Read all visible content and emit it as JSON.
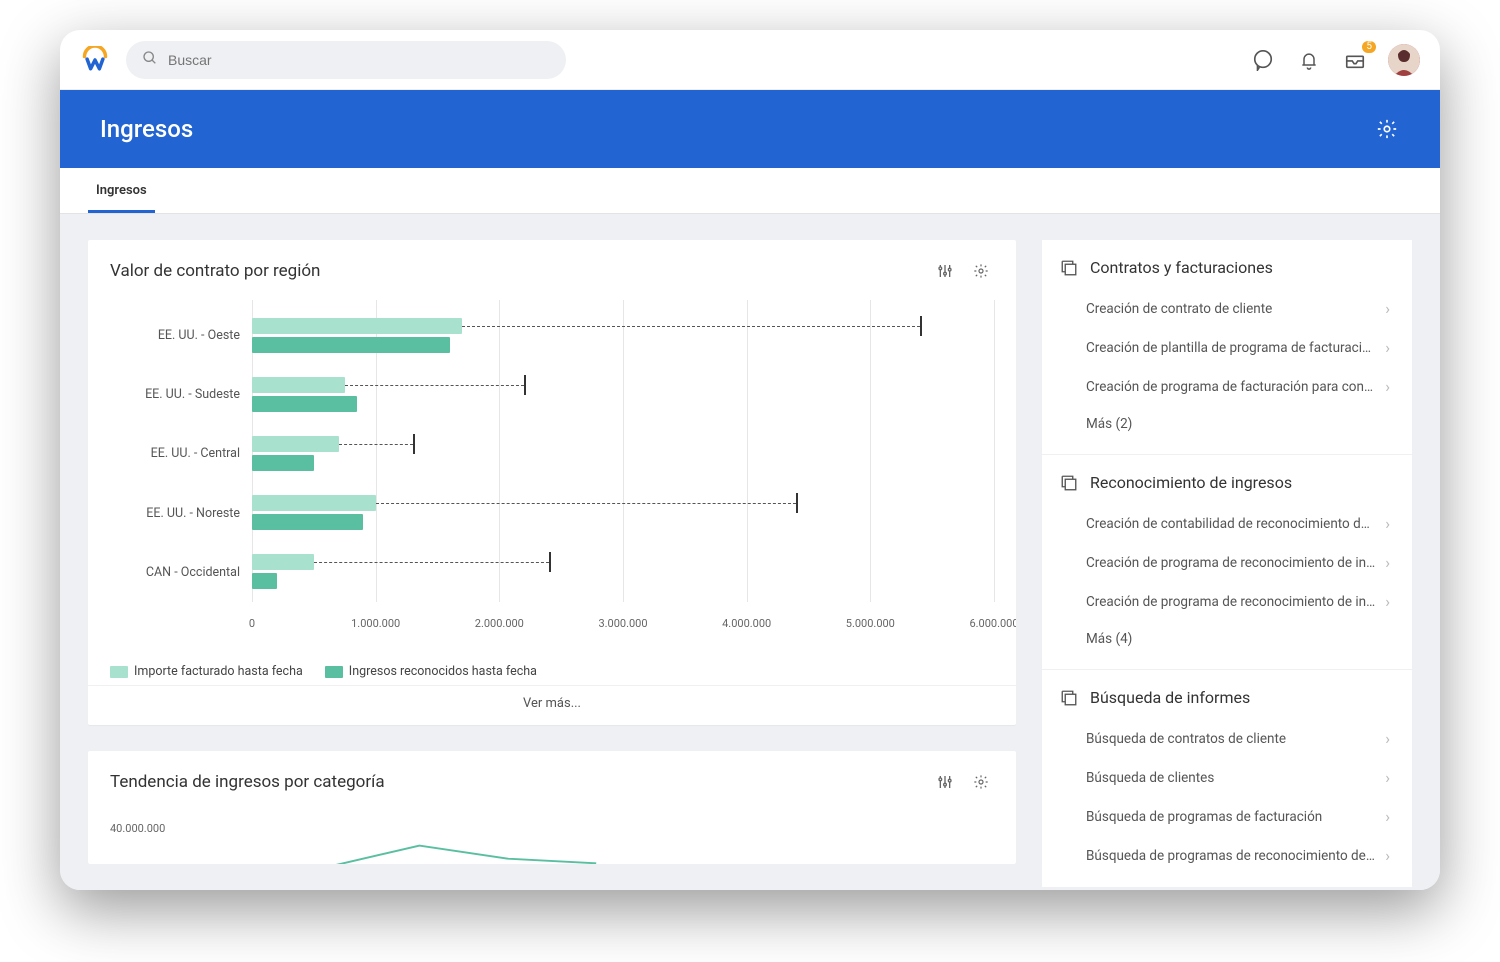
{
  "search": {
    "placeholder": "Buscar"
  },
  "banner": {
    "title": "Ingresos"
  },
  "tabs": [
    {
      "label": "Ingresos"
    }
  ],
  "notifications_badge": "5",
  "chart1": {
    "title": "Valor de contrato por región",
    "see_more": "Ver más...",
    "legend": {
      "s1": "Importe facturado hasta fecha",
      "s2": "Ingresos reconocidos hasta fecha"
    },
    "xticks": [
      "0",
      "1.000.000",
      "2.000.000",
      "3.000.000",
      "4.000.000",
      "5.000.000",
      "6.000.000"
    ]
  },
  "chart2": {
    "title": "Tendencia de ingresos por categoría",
    "ytick": "40.000.000"
  },
  "panels": [
    {
      "title": "Contratos y facturaciones",
      "links": [
        "Creación de contrato de cliente",
        "Creación de plantilla de programa de facturación pa...",
        "Creación de programa de facturación para contrato ...",
        "Más (2)"
      ]
    },
    {
      "title": "Reconocimiento de ingresos",
      "links": [
        "Creación de contabilidad de reconocimiento de ingr...",
        "Creación de programa de reconocimiento de ingres...",
        "Creación de programa de reconocimiento de ingres...",
        "Más (4)"
      ]
    },
    {
      "title": "Búsqueda de informes",
      "links": [
        "Búsqueda de contratos de cliente",
        "Búsqueda de clientes",
        "Búsqueda de programas de facturación",
        "Búsqueda de programas de reconocimiento de ingr..."
      ]
    }
  ],
  "chart_data": [
    {
      "type": "bar",
      "title": "Valor de contrato por región",
      "orientation": "horizontal",
      "categories": [
        "EE. UU. - Oeste",
        "EE. UU. - Sudeste",
        "EE. UU. - Central",
        "EE. UU. - Noreste",
        "CAN - Occidental"
      ],
      "series": [
        {
          "name": "Importe facturado hasta fecha",
          "color": "#a8e1cd",
          "values": [
            1700000,
            750000,
            700000,
            1000000,
            500000
          ]
        },
        {
          "name": "Ingresos reconocidos hasta fecha",
          "color": "#59bfa0",
          "values": [
            1600000,
            850000,
            500000,
            900000,
            200000
          ]
        }
      ],
      "error_markers": [
        5400000,
        2200000,
        1300000,
        4400000,
        2400000
      ],
      "xlabel": "",
      "ylabel": "",
      "xlim": [
        0,
        6000000
      ],
      "xticks": [
        0,
        1000000,
        2000000,
        3000000,
        4000000,
        5000000,
        6000000
      ]
    },
    {
      "type": "line",
      "title": "Tendencia de ingresos por categoría",
      "ylim": [
        0,
        40000000
      ],
      "note": "partially visible"
    }
  ]
}
